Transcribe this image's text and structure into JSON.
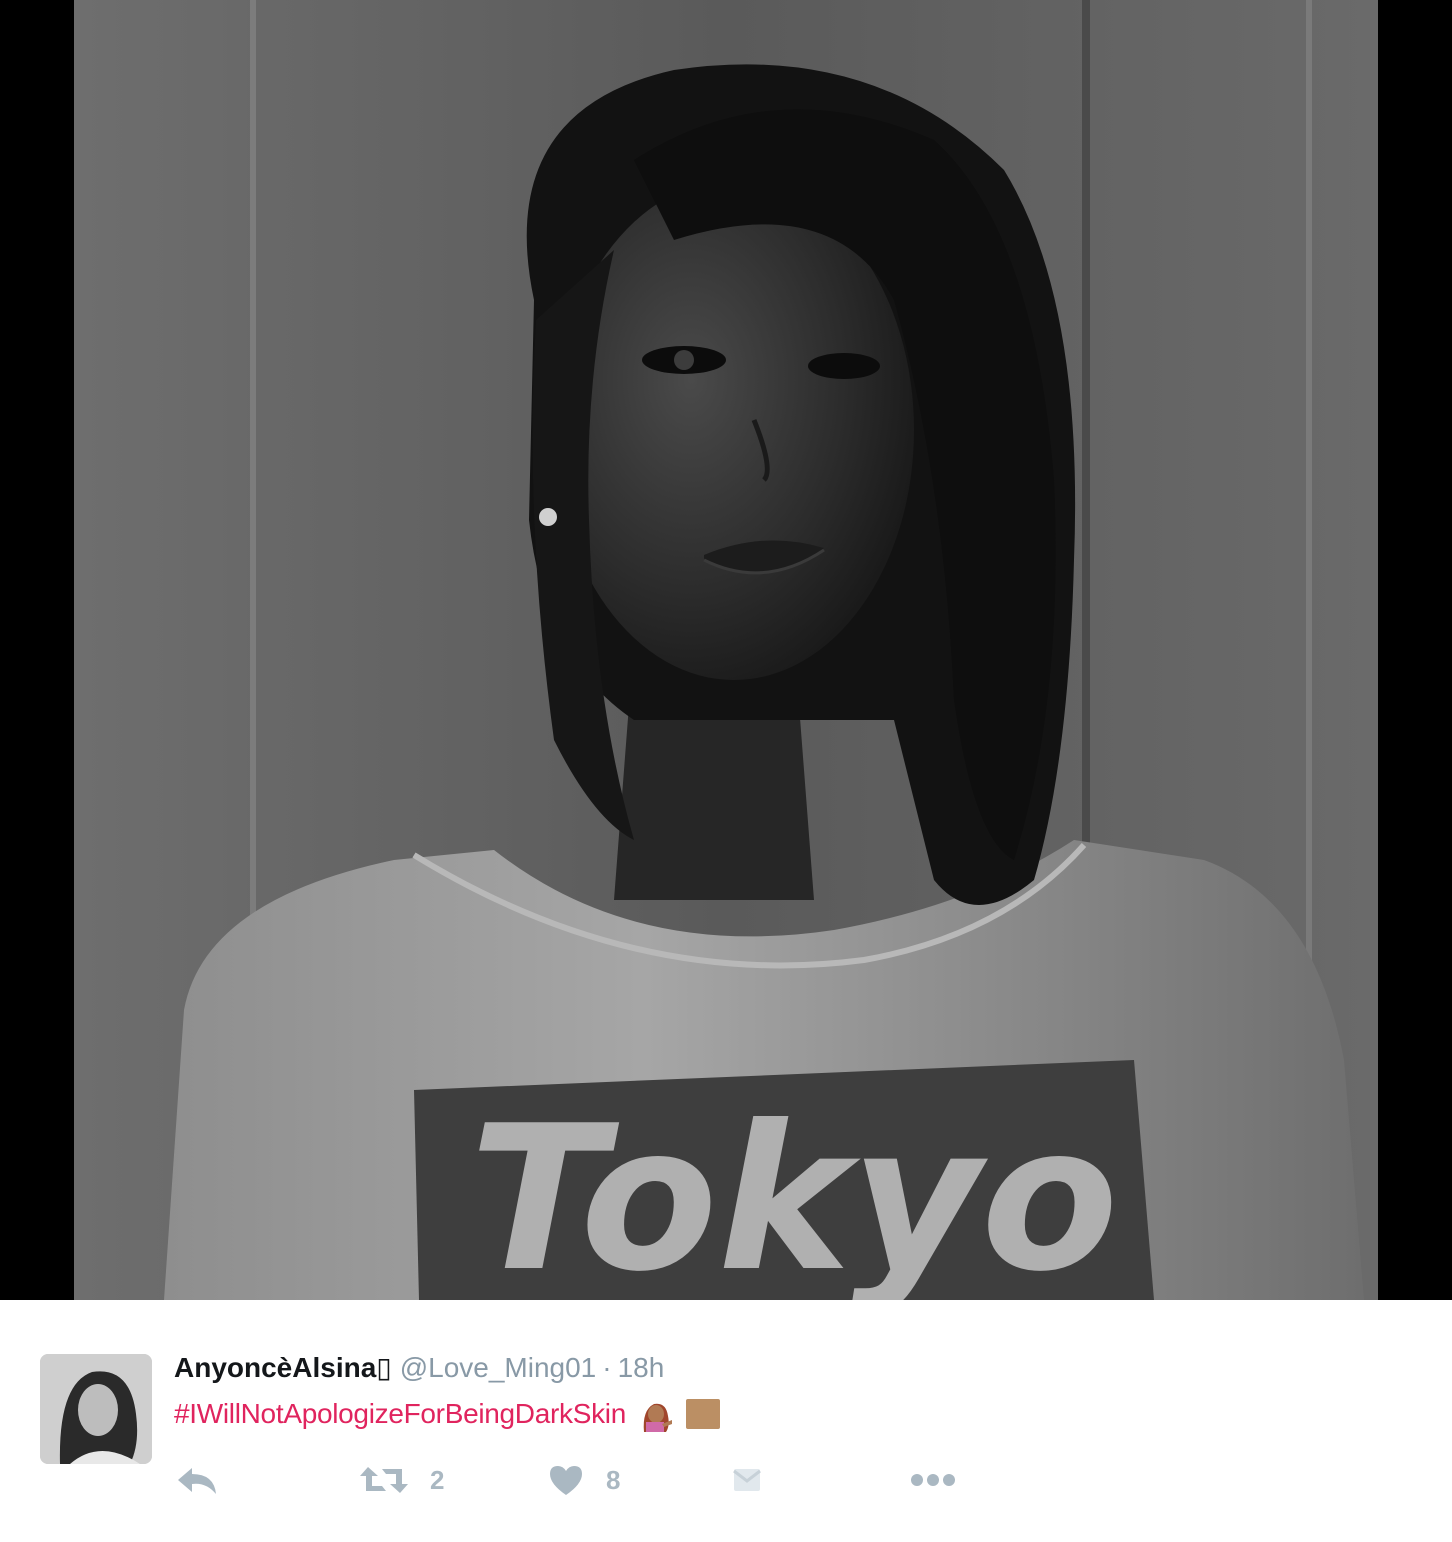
{
  "photo": {
    "description_icon": "portrait-photo",
    "shirt_text": "Tokyo"
  },
  "tweet": {
    "display_name": "AnyoncèAlsina",
    "badge_glyph": "▯",
    "handle": "@Love_Ming01",
    "separator": "·",
    "time": "18h",
    "hashtag": "#IWillNotApologizeForBeingDarkSkin",
    "emoji_1": "woman-tipping-hand-emoji",
    "emoji_2": "medium-dark-skin-tone-swatch",
    "actions": {
      "reply_icon": "reply-icon",
      "retweet_icon": "retweet-icon",
      "retweet_count": "2",
      "like_icon": "heart-icon",
      "like_count": "8",
      "dm_icon": "envelope-icon",
      "more_icon": "more-dots-icon"
    }
  },
  "colors": {
    "hashtag": "#e0245e",
    "muted": "#8899a6",
    "icon": "#aab8c2",
    "name": "#14171a"
  }
}
